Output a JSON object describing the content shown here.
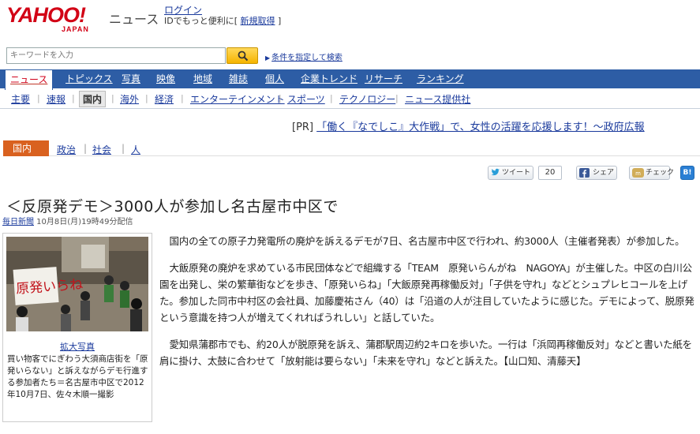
{
  "header": {
    "logo_text": "YAHOO!",
    "logo_sub": "JAPAN",
    "service_name": "ニュース",
    "login_label": "ログイン",
    "login_sub_prefix": "IDでもっと便利に[ ",
    "signup_label": "新規取得",
    "login_sub_suffix": " ]"
  },
  "search": {
    "placeholder": "キーワードを入力",
    "advanced_label": "条件を指定して検索"
  },
  "main_nav": [
    {
      "label": "ニュース",
      "active": true
    },
    {
      "label": "トピックス"
    },
    {
      "label": "写真"
    },
    {
      "label": "映像"
    },
    {
      "label": "地域"
    },
    {
      "label": "雑誌"
    },
    {
      "label": "個人"
    },
    {
      "label": "企業トレンド"
    },
    {
      "label": "リサーチ"
    },
    {
      "label": "ランキング"
    }
  ],
  "sub_nav": [
    {
      "label": "主要"
    },
    {
      "label": "速報"
    },
    {
      "label": "国内",
      "active": true
    },
    {
      "label": "海外"
    },
    {
      "label": "経済"
    },
    {
      "label": "エンターテインメント"
    },
    {
      "label": "スポーツ"
    },
    {
      "label": "テクノロジー"
    },
    {
      "label": "ニュース提供社"
    }
  ],
  "pr": {
    "tag": "[PR] ",
    "text": "「働く『なでしこ』大作戦」で、女性の活躍を応援します！～政府広報"
  },
  "category_bar": {
    "active": "国内",
    "items": [
      "政治",
      "社会",
      "人"
    ]
  },
  "social": {
    "tweet_label": "ツイート",
    "tweet_count": "20",
    "share_label": "シェア",
    "check_label": "チェック",
    "hatena_label": "B!"
  },
  "article": {
    "title": "＜反原発デモ＞3000人が参加し名古屋市中区で",
    "source": "毎日新聞",
    "date": " 10月8日(月)19時49分配信",
    "photo_sign_text": "原発いらね",
    "enlarge_label": "拡大写真",
    "caption": "買い物客でにぎわう大須商店街を「原発いらない」と訴えながらデモ行進する参加者たち＝名古屋市中区で2012年10月7日、佐々木順一撮影",
    "paragraphs": [
      "国内の全ての原子力発電所の廃炉を訴えるデモが7日、名古屋市中区で行われ、約3000人（主催者発表）が参加した。",
      "大飯原発の廃炉を求めている市民団体などで組織する「TEAM　原発いらんがね　NAGOYA」が主催した。中区の白川公園を出発し、栄の繁華街などを歩き、「原発いらね」「大飯原発再稼働反対」「子供を守れ」などとシュプレヒコールを上げた。参加した同市中村区の会社員、加藤慶祐さん（40）は「沿道の人が注目していたように感じた。デモによって、脱原発という意識を持つ人が増えてくれればうれしい」と話していた。",
      "愛知県蒲郡市でも、約20人が脱原発を訴え、蒲郡駅周辺約2キロを歩いた。一行は「浜岡再稼働反対」などと書いた紙を肩に掛け、太鼓に合わせて「放射能は要らない」「未来を守れ」などと訴えた。【山口知、清藤天】"
    ]
  },
  "colors": {
    "nav_blue": "#2d5da5",
    "category_orange": "#d9611f",
    "logo_red": "#d20015",
    "link_blue": "#1a3a9c"
  }
}
